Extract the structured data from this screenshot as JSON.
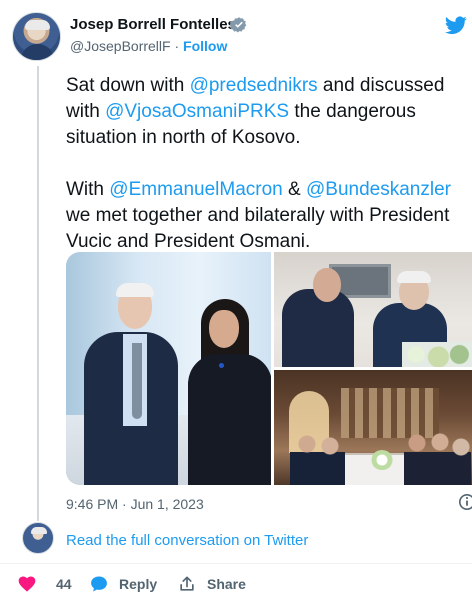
{
  "author": {
    "name": "Josep Borrell Fontelles",
    "handle": "@JosepBorrellF",
    "separator": "·",
    "follow_label": "Follow",
    "verified_icon": "verified-badge-icon",
    "avatar_icon": "profile-avatar",
    "platform_icon": "twitter-bird-icon"
  },
  "tweet": {
    "paragraph1": {
      "intro": "Sat down with ",
      "mention1": "@predsednikrs",
      "middle1": " and discussed",
      "line2_prefix": "with ",
      "mention2": "@VjosaOsmaniPRKS",
      "line2_suffix": " the dangerous",
      "line3": "situation in north of Kosovo."
    },
    "paragraph2": {
      "intro": "With ",
      "mention1": "@EmmanuelMacron",
      "middle": " & ",
      "mention2": "@Bundeskanzler",
      "line2": "we met together and bilaterally with President",
      "line3": "Vucic and President Osmani."
    },
    "images": [
      {
        "name": "meeting-photo-1",
        "subject": "two people standing in a conference hall"
      },
      {
        "name": "meeting-photo-2",
        "subject": "two men seated in conversation"
      },
      {
        "name": "meeting-photo-3",
        "subject": "delegations around a meeting table"
      }
    ],
    "timestamp": "9:46 PM · Jun 1, 2023",
    "info_icon": "info-icon"
  },
  "conversation": {
    "link_label": "Read the full conversation on Twitter",
    "avatar_icon": "small-profile-avatar"
  },
  "actions": {
    "like_count": "44",
    "like_icon": "heart-icon",
    "reply_label": "Reply",
    "reply_icon": "reply-bubble-icon",
    "share_label": "Share",
    "share_icon": "share-upload-icon"
  },
  "colors": {
    "accent": "#1d9bf0",
    "text": "#0f1419",
    "secondary_text": "#536471",
    "like": "#f91880"
  }
}
